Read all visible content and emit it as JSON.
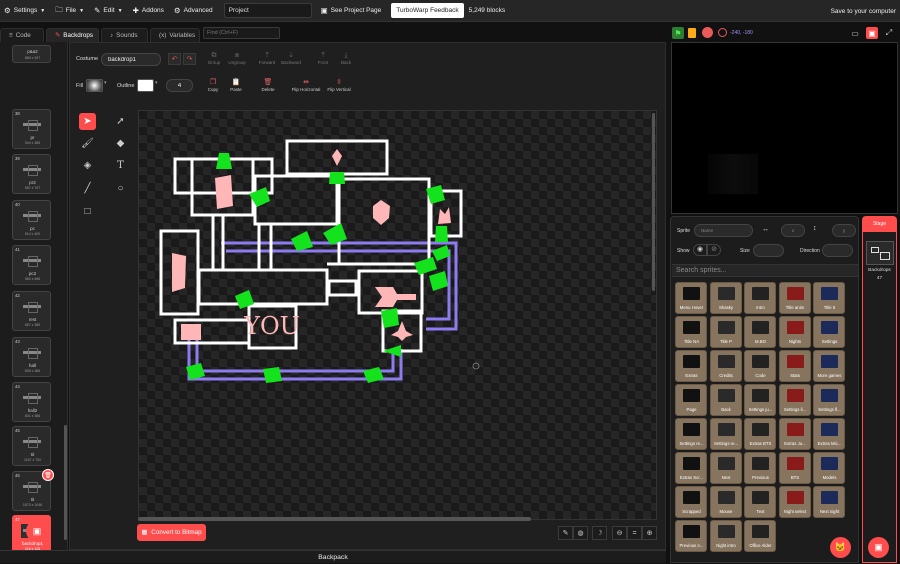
{
  "menubar": {
    "settings": "Settings",
    "file": "File",
    "edit": "Edit",
    "addons": "Addons",
    "advanced": "Advanced",
    "project_title": "Project",
    "see_project_page": "See Project Page",
    "turbowarp_feedback": "TurboWarp Feedback",
    "block_count": "5,249 blocks",
    "save": "Save to your computer"
  },
  "tabs": {
    "code": "Code",
    "backdrops": "Backdrops",
    "sounds": "Sounds",
    "variables": "Variables"
  },
  "find_placeholder": "Find (Ctrl+F)",
  "costumes": [
    {
      "num": "",
      "name": "p&a2",
      "size": "880 x 497",
      "selected": false
    },
    {
      "num": "38",
      "name": "pr",
      "size": "544 x 385",
      "selected": false
    },
    {
      "num": "39",
      "name": "pr2",
      "size": "587 x 707",
      "selected": false
    },
    {
      "num": "40",
      "name": "pc",
      "size": "514 x 400",
      "selected": false
    },
    {
      "num": "41",
      "name": "pc2",
      "size": "580 x 696",
      "selected": false
    },
    {
      "num": "42",
      "name": "rest",
      "size": "657 x 385",
      "selected": false
    },
    {
      "num": "43",
      "name": "hall",
      "size": "839 x 386",
      "selected": false
    },
    {
      "num": "44",
      "name": "hall2",
      "size": "841 x 386",
      "selected": false
    },
    {
      "num": "45",
      "name": "tit",
      "size": "1167 x 700",
      "selected": false
    },
    {
      "num": "46",
      "name": "tit",
      "size": "1670 x 1046",
      "selected": false
    },
    {
      "num": "47",
      "name": "backdrop1",
      "size": "216 x 125",
      "selected": true
    }
  ],
  "toolbar": {
    "costume_label": "Costume",
    "costume_name": "backdrop1",
    "group": "Group",
    "ungroup": "Ungroup",
    "forward": "Forward",
    "backward": "Backward",
    "front": "Front",
    "back": "Back",
    "fill_label": "Fill",
    "outline_label": "Outline",
    "outline_width": "4",
    "copy": "Copy",
    "paste": "Paste",
    "delete": "Delete",
    "flip_h": "Flip Horizontal",
    "flip_v": "Flip Vertical"
  },
  "canvas_text": "YOU",
  "convert_btn": "Convert to Bitmap",
  "zoom_reset": "=",
  "backpack": "Backpack",
  "stage_header": {
    "coords": "-240, -180"
  },
  "sprite_info": {
    "sprite_label": "Sprite",
    "name_placeholder": "Name",
    "x_placeholder": "x",
    "y_placeholder": "y",
    "show_label": "Show",
    "size_label": "Size",
    "direction_label": "Direction"
  },
  "search_sprites": "Search sprites...",
  "sprites": [
    "Menu Hover",
    "Shasky",
    "Intro",
    "Title anim",
    "Title 5",
    "Title NA",
    "Title P",
    "M.BO",
    "Nights",
    "Settings",
    "Extras",
    "Credits",
    "Code",
    "Stats",
    "More games",
    "Page",
    "Back",
    "Settings ju...",
    "Settings li...",
    "Settings fl...",
    "Settings re...",
    "Settings re...",
    "Extras BTS",
    "Extras Ju...",
    "Extras Mic...",
    "Extras Scr...",
    "Next",
    "Previous",
    "BTS",
    "Models",
    "Scrapped",
    "Mouse",
    "Text",
    "Night select",
    "Next night",
    "Previous n...",
    "Night intro",
    "Office Alder"
  ],
  "stage_target": {
    "header": "Stage",
    "label": "Backdrops",
    "count": "47"
  },
  "colors": {
    "accent": "#ff4c4c",
    "map_wall": "#ffffff",
    "vent": "#8c7cf0",
    "camera": "#14e21c",
    "sprite_tile": "#86745f"
  }
}
